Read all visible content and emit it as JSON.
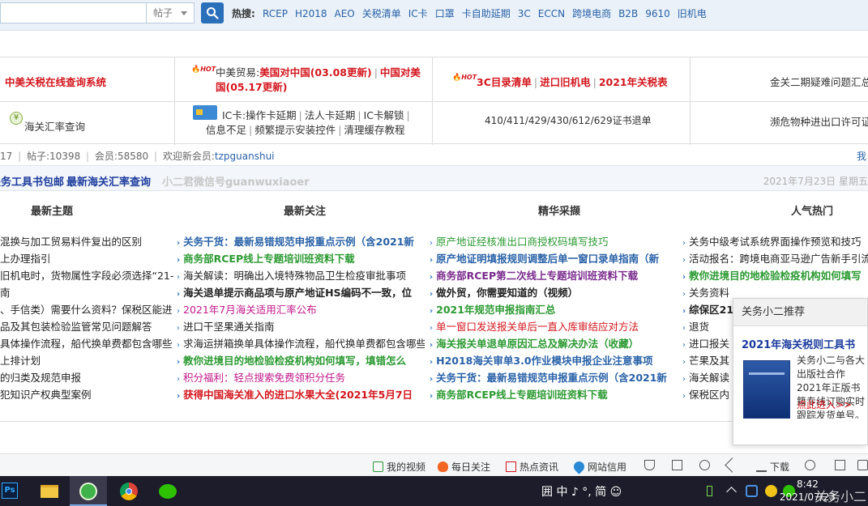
{
  "search": {
    "scope": "帖子",
    "hot_label": "热搜:",
    "hot_links": [
      "RCEP",
      "H2018",
      "AEO",
      "关税清单",
      "IC卡",
      "口罩",
      "卡自助延期",
      "3C",
      "ECCN",
      "跨境电商",
      "B2B",
      "9610",
      "旧机电"
    ]
  },
  "quick_links": {
    "row1": {
      "c1": "中美关税在线查询系统",
      "c2_prefix": "中美贸易:",
      "c2_a": "美国对中国(03.08更新)",
      "c2_b": "中国对美国(05.17更新)",
      "c3_a": "3C目录清单",
      "c3_b": "进口旧机电",
      "c3_c": "2021年关税表",
      "c4": "金关二期疑难问题汇总"
    },
    "row2": {
      "c1": "海关汇率查询",
      "c2_prefix": "IC卡:",
      "c2_a": "操作卡延期",
      "c2_b": "法人卡延期",
      "c2_c": "IC卡解锁",
      "c2_d": "信息不足",
      "c2_e": "频繁提示安装控件",
      "c2_f": "清理缓存教程",
      "c3": "410/411/429/430/612/629证书退单",
      "c4": "濒危物种进出口许可证"
    }
  },
  "stats": {
    "left_num": "17",
    "posts_label": "帖子:",
    "posts": "10398",
    "members_label": "会员:",
    "members": "58580",
    "welcome": "欢迎新会员:",
    "new_member": "tzpguanshui",
    "right": "我"
  },
  "announce": {
    "a1": "关务工具书包邮",
    "a2": "最新海关汇率查询",
    "a3": "小二君微信号guanwuxiaoer",
    "date": "2021年7月23日 星期五"
  },
  "columns": {
    "headers": [
      "最新主题",
      "最新关注",
      "精华采撷",
      "人气热门"
    ],
    "col1": [
      "混换与加工贸易料件复出的区别",
      "上办理指引",
      "旧机电时，货物属性字段必须选择“21-",
      "南",
      "、手信类）需要什么资料？保税区能进",
      "品及其包装检验监管常见问题解答",
      "具体操作流程，船代换单费都包含哪些",
      "上排计划",
      "的归类及规范申报",
      "犯知识产权典型案例"
    ],
    "col2": [
      "关务干货：最新易错规范申报重点示例（含2021新",
      "商务部RCEP线上专题培训班资料下载",
      "海关解读：明确出入境特殊物品卫生检疫审批事项",
      "海关退单提示商品项与原产地证HS编码不一致，位",
      "2021年7月海关适用汇率公布",
      "进口干坚果通关指南",
      "求海运拼箱换单具体操作流程，船代换单费都包含哪些",
      "教你进境目的地检验检疫机构如何填写，填错怎么",
      "积分福利：轻点搜索免费领积分任务",
      "获得中国海关准入的进口水果大全(2021年5月7日"
    ],
    "col3": [
      "原产地证经核准出口商授权码填写技巧",
      "原产地证明填报规则调整后单一窗口录单指南（新",
      "商务部RCEP第二次线上专题培训班资料下载",
      "做外贸，你需要知道的（视频）",
      "2021年规范申报指南汇总",
      "单一窗口发送报关单后一直入库审结应对方法",
      "海关报关单退单原因汇总及解决办法（收藏）",
      "H2018海关审单3.0作业模块申报企业注意事项",
      "关务干货：最新易错规范申报重点示例（含2021新",
      "商务部RCEP线上专题培训班资料下载"
    ],
    "col4": [
      "关务中级考试系统界面操作预览和技巧",
      "活动报名：跨境电商亚马逊广告新手引流",
      "教你进境目的地检验检疫机构如何填写",
      "关务资料",
      "综保区21",
      "退货",
      "进口报关",
      "芒果及其",
      "海关解读",
      "保税区内"
    ]
  },
  "popup": {
    "head": "关务小二推荐",
    "title": "2021年海关税则工具书",
    "text": "关务小二与各大出版社合作2021年正版书籍专线订购实时跟踪发货单号。",
    "link": "点此进入>>"
  },
  "statusbar": [
    "我的视频",
    "每日关注",
    "热点资讯",
    "网站信用",
    "下载"
  ],
  "taskbar": {
    "ime": "囲 中 ♪ °, 简 ☺",
    "time": "8:42",
    "date": "2021/07/23",
    "watermark": "关务小二"
  }
}
